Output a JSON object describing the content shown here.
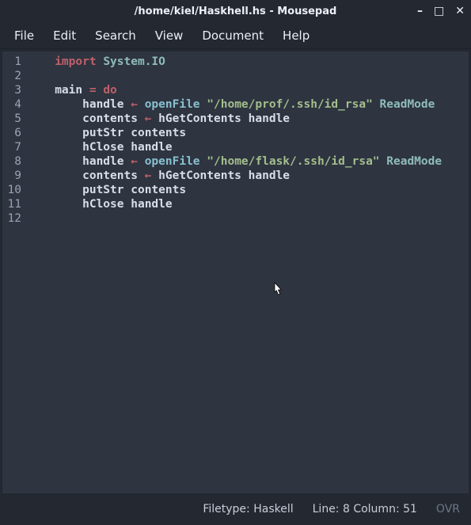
{
  "titlebar": {
    "title": "/home/kiel/Haskhell.hs - Mousepad",
    "min_icon": "–",
    "max_icon": "□",
    "close_icon": "✕"
  },
  "menu": {
    "file": "File",
    "edit": "Edit",
    "search": "Search",
    "view": "View",
    "document": "Document",
    "help": "Help"
  },
  "gutter": [
    "1",
    "2",
    "3",
    "4",
    "5",
    "6",
    "7",
    "8",
    "9",
    "10",
    "11",
    "12"
  ],
  "code": {
    "l1_import": "import",
    "l1_mod": "System.IO",
    "l3_main": "main",
    "l3_eq": " = ",
    "l3_do": "do",
    "l4_handle": "handle",
    "l4_arrow": " ← ",
    "l4_open": "openFile",
    "l4_sp": " ",
    "l4_str": "\"/home/prof/.ssh/id_rsa\"",
    "l4_sp2": " ",
    "l4_mode": "ReadMode",
    "l5_contents": "contents",
    "l5_arrow": " ← ",
    "l5_fn": "hGetContents",
    "l5_sp": " ",
    "l5_arg": "handle",
    "l6_fn": "putStr",
    "l6_sp": " ",
    "l6_arg": "contents",
    "l7_fn": "hClose",
    "l7_sp": " ",
    "l7_arg": "handle",
    "l8_handle": "handle",
    "l8_arrow": " ← ",
    "l8_open": "openFile",
    "l8_sp": " ",
    "l8_str": "\"/home/flask/.ssh/id_rsa\"",
    "l8_sp2": " ",
    "l8_mode": "ReadMode",
    "l9_contents": "contents",
    "l9_arrow": " ← ",
    "l9_fn": "hGetContents",
    "l9_sp": " ",
    "l9_arg": "handle",
    "l10_fn": "putStr",
    "l10_sp": " ",
    "l10_arg": "contents",
    "l11_fn": "hClose",
    "l11_sp": " ",
    "l11_arg": "handle"
  },
  "status": {
    "filetype": "Filetype: Haskell",
    "position": "Line: 8 Column: 51",
    "mode": "OVR"
  }
}
